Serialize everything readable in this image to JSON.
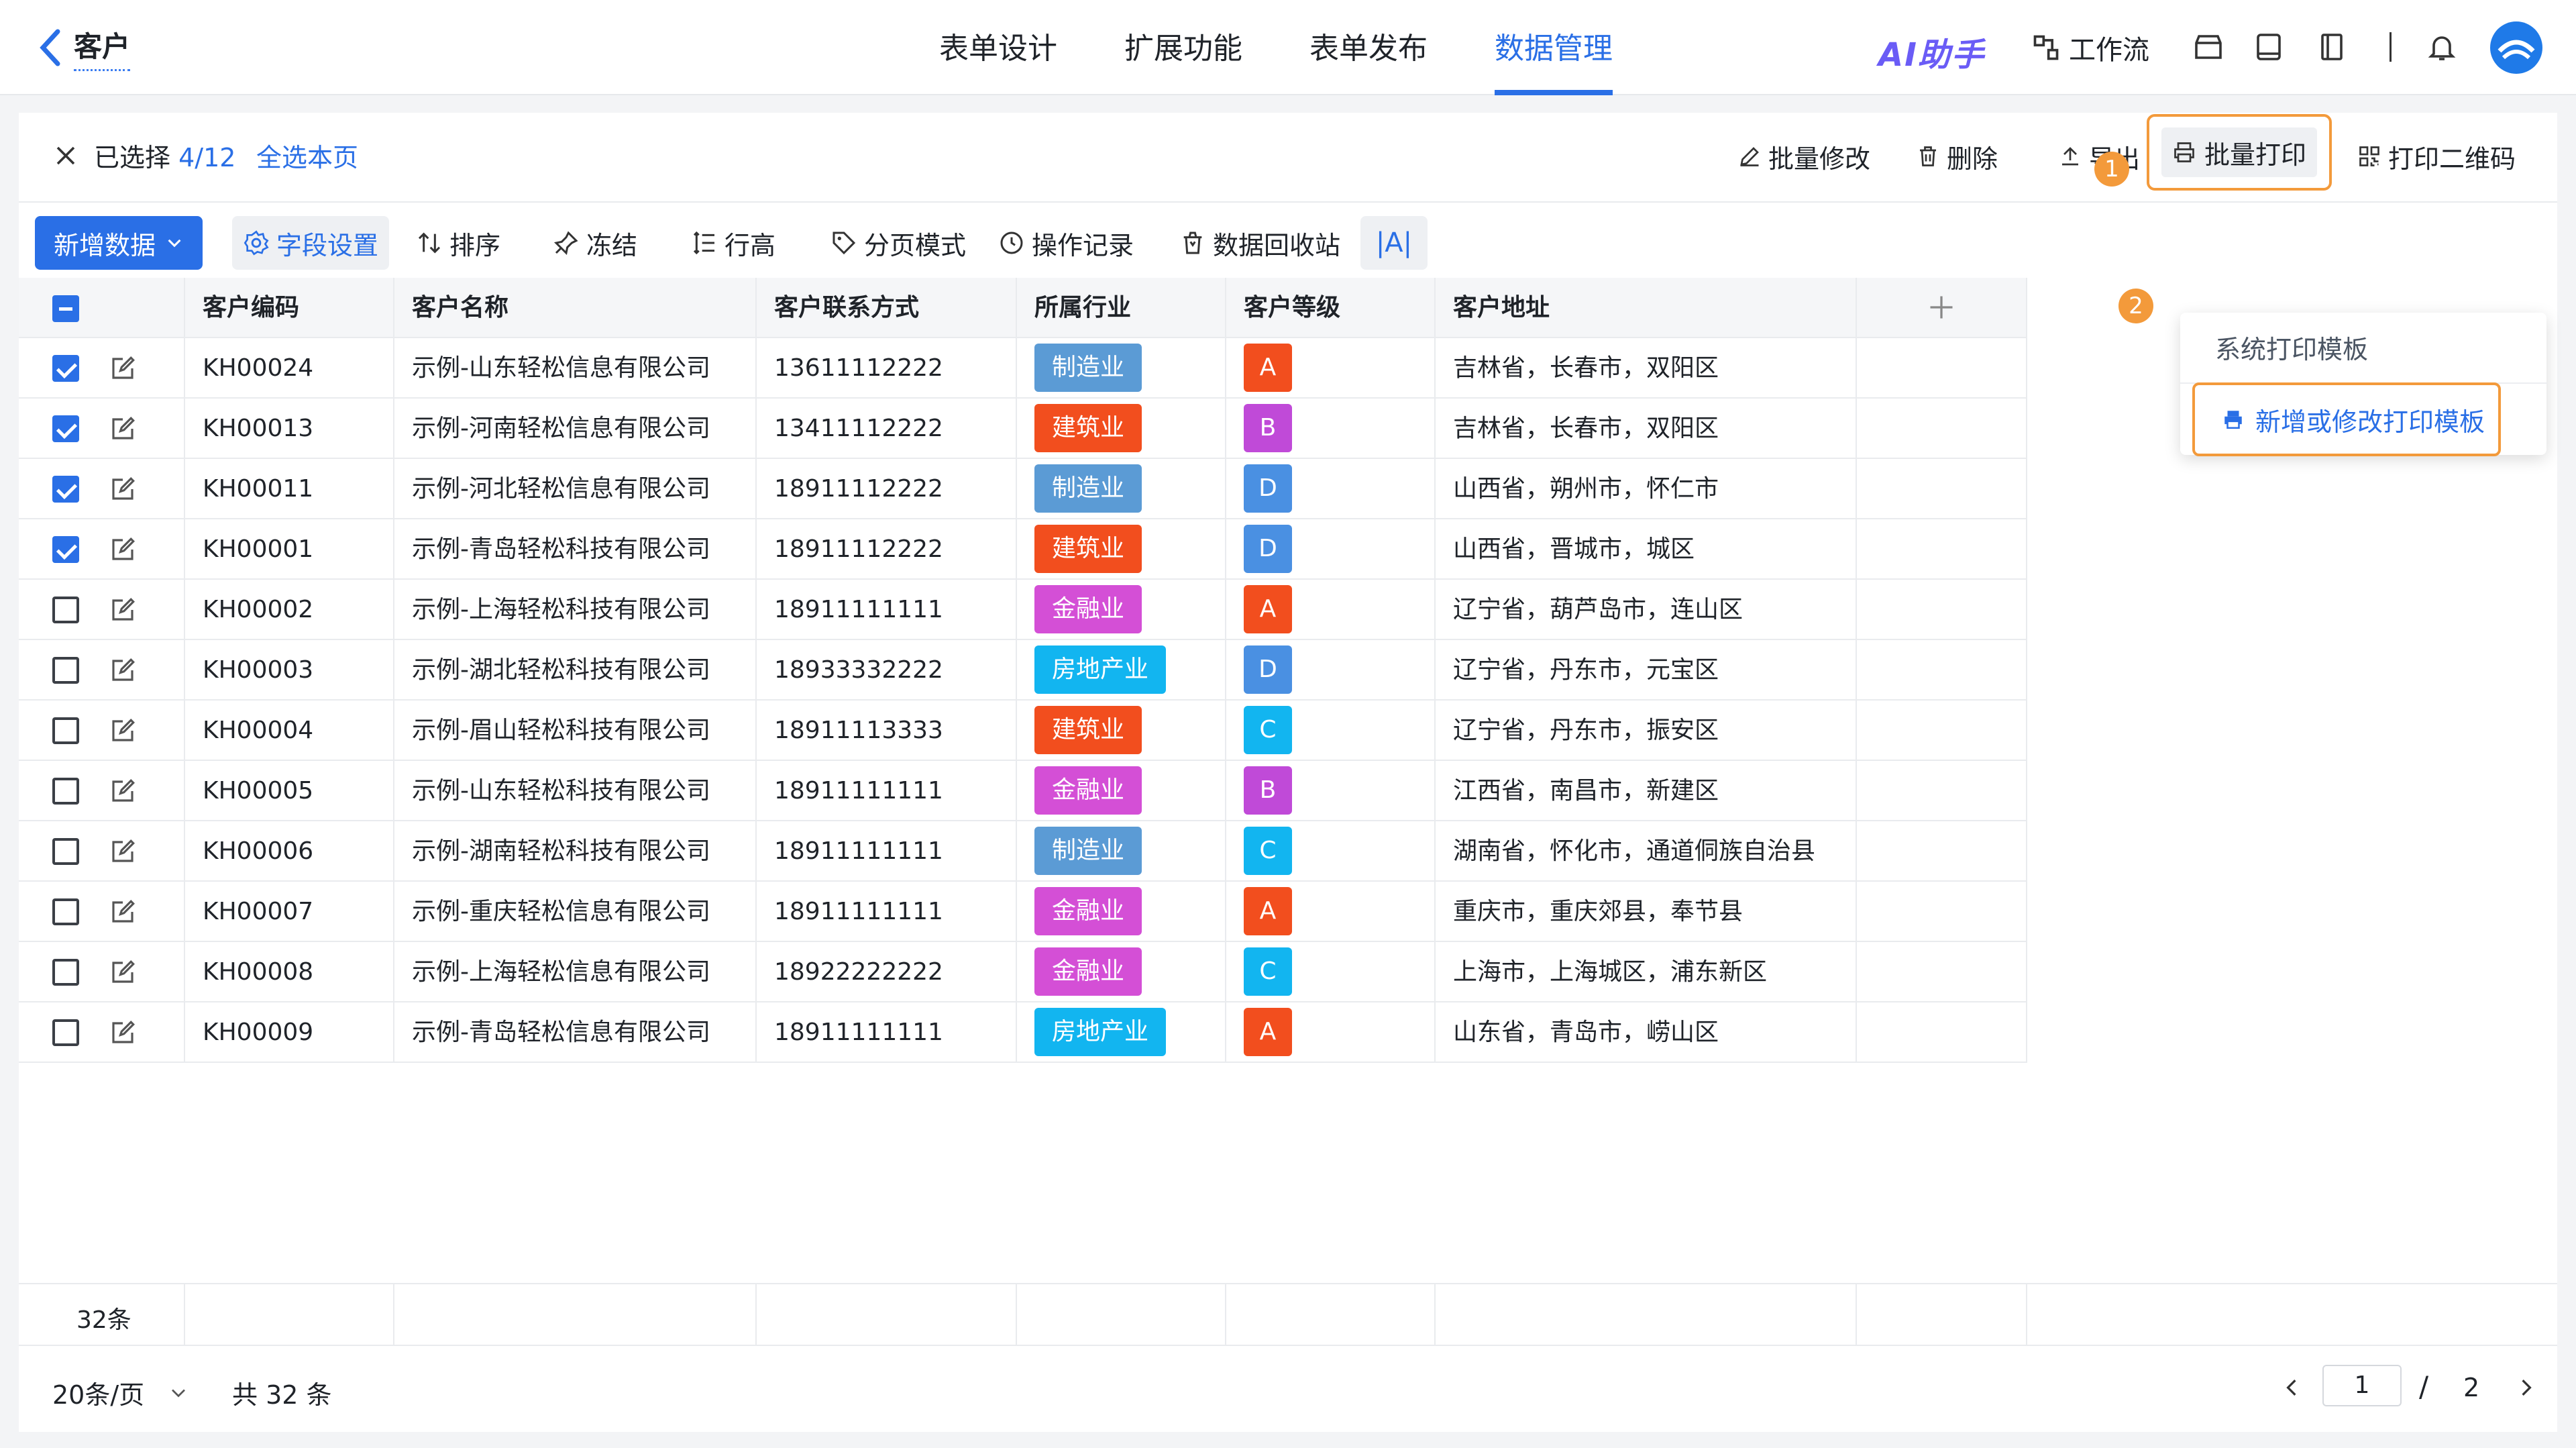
{
  "header": {
    "back_title": "客户",
    "tabs": [
      "表单设计",
      "扩展功能",
      "表单发布",
      "数据管理"
    ],
    "active_tab": "数据管理",
    "ai_label": "AI助手",
    "workflow_label": "工作流"
  },
  "selection_bar": {
    "selected_prefix": "已选择",
    "selected_count": "4/12",
    "select_page": "全选本页",
    "actions": {
      "bulk_edit": "批量修改",
      "delete": "删除",
      "export": "导出",
      "bulk_print": "批量打印",
      "print_qr": "打印二维码"
    },
    "step_badges": [
      "1",
      "2"
    ]
  },
  "toolbar": {
    "add": "新增数据",
    "field_settings": "字段设置",
    "sort": "排序",
    "freeze": "冻结",
    "row_height": "行高",
    "pagination_mode": "分页模式",
    "operation_log": "操作记录",
    "recycle_bin": "数据回收站",
    "col_width": "|A|"
  },
  "print_dropdown": {
    "items": [
      "系统打印模板",
      "新增或修改打印模板"
    ]
  },
  "table": {
    "columns": [
      "客户编码",
      "客户名称",
      "客户联系方式",
      "所属行业",
      "客户等级",
      "客户地址"
    ],
    "rows": [
      {
        "checked": true,
        "code": "KH00024",
        "name": "示例-山东轻松信息有限公司",
        "phone": "13611112222",
        "industry": "制造业",
        "level": "A",
        "address": "吉林省，长春市，双阳区"
      },
      {
        "checked": true,
        "code": "KH00013",
        "name": "示例-河南轻松信息有限公司",
        "phone": "13411112222",
        "industry": "建筑业",
        "level": "B",
        "address": "吉林省，长春市，双阳区"
      },
      {
        "checked": true,
        "code": "KH00011",
        "name": "示例-河北轻松信息有限公司",
        "phone": "18911112222",
        "industry": "制造业",
        "level": "D",
        "address": "山西省，朔州市，怀仁市"
      },
      {
        "checked": true,
        "code": "KH00001",
        "name": "示例-青岛轻松科技有限公司",
        "phone": "18911112222",
        "industry": "建筑业",
        "level": "D",
        "address": "山西省，晋城市，城区"
      },
      {
        "checked": false,
        "code": "KH00002",
        "name": "示例-上海轻松科技有限公司",
        "phone": "18911111111",
        "industry": "金融业",
        "level": "A",
        "address": "辽宁省，葫芦岛市，连山区"
      },
      {
        "checked": false,
        "code": "KH00003",
        "name": "示例-湖北轻松科技有限公司",
        "phone": "18933332222",
        "industry": "房地产业",
        "level": "D",
        "address": "辽宁省，丹东市，元宝区"
      },
      {
        "checked": false,
        "code": "KH00004",
        "name": "示例-眉山轻松科技有限公司",
        "phone": "18911113333",
        "industry": "建筑业",
        "level": "C",
        "address": "辽宁省，丹东市，振安区"
      },
      {
        "checked": false,
        "code": "KH00005",
        "name": "示例-山东轻松科技有限公司",
        "phone": "18911111111",
        "industry": "金融业",
        "level": "B",
        "address": "江西省，南昌市，新建区"
      },
      {
        "checked": false,
        "code": "KH00006",
        "name": "示例-湖南轻松科技有限公司",
        "phone": "18911111111",
        "industry": "制造业",
        "level": "C",
        "address": "湖南省，怀化市，通道侗族自治县"
      },
      {
        "checked": false,
        "code": "KH00007",
        "name": "示例-重庆轻松信息有限公司",
        "phone": "18911111111",
        "industry": "金融业",
        "level": "A",
        "address": "重庆市，重庆郊县，奉节县"
      },
      {
        "checked": false,
        "code": "KH00008",
        "name": "示例-上海轻松信息有限公司",
        "phone": "18922222222",
        "industry": "金融业",
        "level": "C",
        "address": "上海市，上海城区，浦东新区"
      },
      {
        "checked": false,
        "code": "KH00009",
        "name": "示例-青岛轻松信息有限公司",
        "phone": "18911111111",
        "industry": "房地产业",
        "level": "A",
        "address": "山东省，青岛市，崂山区"
      }
    ],
    "industry_colors": {
      "制造业": "#5b9bd5",
      "建筑业": "#f24e1e",
      "金融业": "#d44fd6",
      "房地产业": "#12b5f0"
    },
    "level_colors": {
      "A": "#f24e1e",
      "B": "#c04ad8",
      "C": "#12b5f0",
      "D": "#4a90e2"
    }
  },
  "footer": {
    "count_label": "32条",
    "page_size": "20条/页",
    "total": "共 32 条",
    "current_page": "1",
    "page_sep": "/",
    "total_pages": "2"
  },
  "colors": {
    "accent": "#2a6fe6",
    "highlight": "#f39a3b"
  }
}
